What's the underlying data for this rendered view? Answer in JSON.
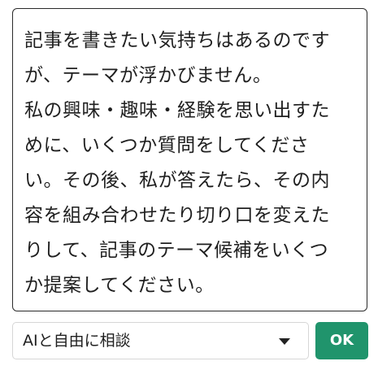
{
  "prompt": {
    "lines": [
      "記事を書きたい気持ちはあるのです",
      "が、テーマが浮かびません。",
      "私の興味・趣味・経験を思い出すた",
      "めに、いくつか質問をしてくださ",
      "い。その後、私が答えたら、その内",
      "容を組み合わせたり切り口を変えた",
      "りして、記事のテーマ候補をいくつ",
      "か提案してください。"
    ]
  },
  "mode_select": {
    "selected": "AIと自由に相談",
    "icon": "chevron-down-icon"
  },
  "ok_button": {
    "label": "OK",
    "color": "#20946c"
  }
}
